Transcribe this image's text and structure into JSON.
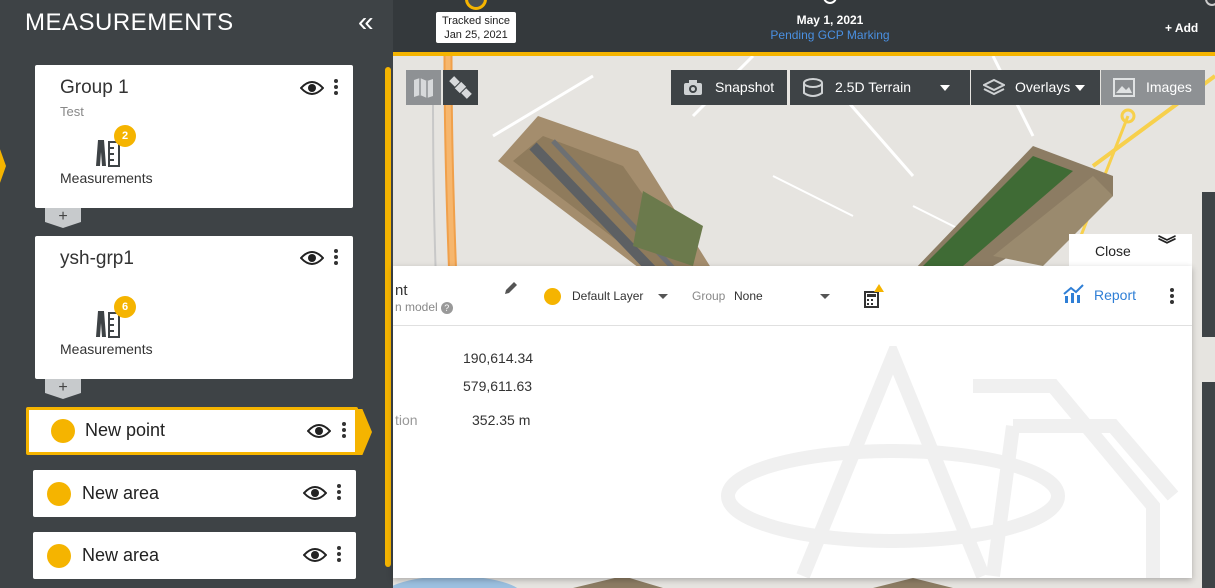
{
  "sidebar": {
    "title": "MEASUREMENTS",
    "collapse_glyph": "«",
    "groups": [
      {
        "name": "Group 1",
        "subtitle": "Test",
        "count": "2",
        "measurements_label": "Measurements",
        "add_glyph": "+"
      },
      {
        "name": "ysh-grp1",
        "subtitle": "",
        "count": "6",
        "measurements_label": "Measurements",
        "add_glyph": "+"
      }
    ],
    "items": [
      {
        "label": "New point",
        "active": true
      },
      {
        "label": "New area",
        "active": false
      },
      {
        "label": "New area",
        "active": false
      }
    ]
  },
  "topbar": {
    "tracked_line1": "Tracked since",
    "tracked_line2": "Jan 25, 2021",
    "date": "May 1, 2021",
    "status": "Pending GCP Marking",
    "add_label": "+ Add"
  },
  "map_toolbar": {
    "snapshot": "Snapshot",
    "terrain": "2.5D Terrain",
    "overlays": "Overlays",
    "images": "Images",
    "icons": [
      "camera-icon",
      "terrain-icon",
      "layers-icon",
      "image-icon",
      "map-icon",
      "satellite-icon"
    ]
  },
  "panel": {
    "close_label": "Close",
    "close_glyph": "︾",
    "title_fragment": "nt",
    "subtitle_fragment": "n model",
    "help_glyph": "?",
    "layer": "Default Layer",
    "group_label": "Group",
    "group_value": "None",
    "report_label": "Report",
    "values": [
      {
        "label": "",
        "value": "190,614.34"
      },
      {
        "label": "",
        "value": "579,611.63"
      },
      {
        "label": "tion",
        "value": "352.35 m"
      }
    ]
  },
  "colors": {
    "accent": "#f5b400",
    "sidebar": "#3e4346",
    "topbar": "#34393c",
    "link": "#2f7fd6"
  }
}
